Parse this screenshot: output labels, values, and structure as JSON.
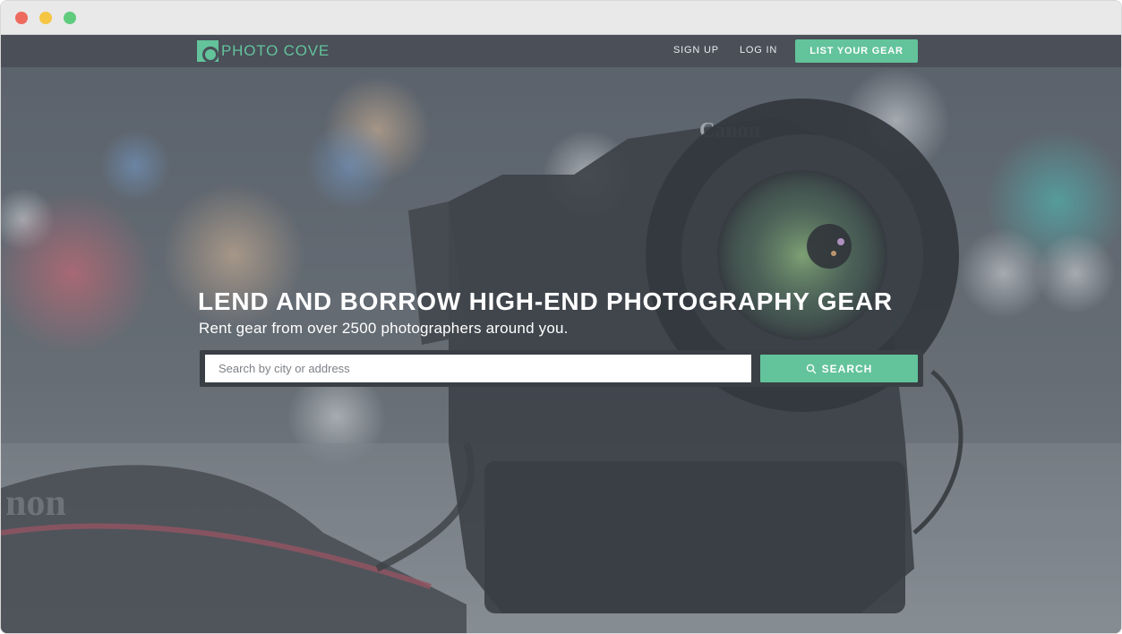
{
  "window": {
    "controls": [
      "close",
      "minimize",
      "maximize"
    ]
  },
  "nav": {
    "logo_text": "PHOTO COVE",
    "logo_icon": "camera-logo-icon",
    "links": {
      "signup": "SIGN UP",
      "login": "LOG IN"
    },
    "cta": "LIST YOUR GEAR"
  },
  "hero": {
    "headline": "LEND AND BORROW HIGH-END PHOTOGRAPHY GEAR",
    "subline": "Rent gear from over 2500 photographers around you.",
    "search": {
      "placeholder": "Search by city or address",
      "value": "",
      "button_label": "SEARCH",
      "button_icon": "search-icon"
    },
    "background_image": "camera-photo-with-bokeh"
  },
  "colors": {
    "brand_green": "#63c39b",
    "nav_bg": "#4a4f58",
    "search_bar_bg": "#3a3f45"
  }
}
